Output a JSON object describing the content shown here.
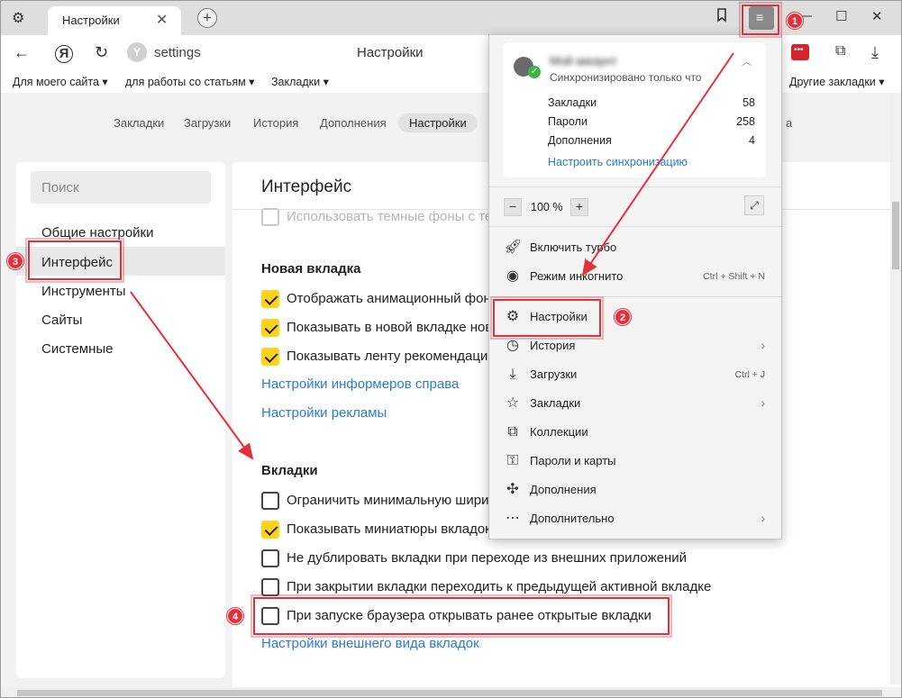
{
  "browser": {
    "tab_title": "Настройки",
    "tab_close": "✕",
    "new_tab": "+",
    "url": "settings",
    "page_title": "Настройки",
    "ya_logo": "Я",
    "bookmarks_bar": [
      "Для моего сайта ▾",
      "для работы со статьям ▾",
      "Закладки ▾"
    ],
    "other_bookmarks": "Другие закладки ▾"
  },
  "settings_tabs": [
    "Закладки",
    "Загрузки",
    "История",
    "Дополнения",
    "Настройки"
  ],
  "settings_tabs_overflow": "а",
  "sidebar": {
    "search_placeholder": "Поиск",
    "items": [
      "Общие настройки",
      "Интерфейс",
      "Инструменты",
      "Сайты",
      "Системные"
    ],
    "active_index": 1
  },
  "main": {
    "title": "Интерфейс",
    "dark_bg_row": "Использовать темные фоны с те",
    "new_tab_section": "Новая вкладка",
    "new_tab_options": [
      {
        "label": "Отображать анимационный фон",
        "checked": true
      },
      {
        "label": "Показывать в новой вкладке нов",
        "checked": true
      },
      {
        "label": "Показывать ленту рекомендаци",
        "checked": true
      }
    ],
    "links_1": [
      "Настройки информеров справа",
      "Настройки рекламы"
    ],
    "tabs_section": "Вкладки",
    "tabs_options": [
      {
        "label": "Ограничить минимальную шири",
        "checked": false
      },
      {
        "label": "Показывать миниатюры вкладок",
        "checked": true
      },
      {
        "label": "Не дублировать вкладки при переходе из внешних приложений",
        "checked": false
      },
      {
        "label": "При закрытии вкладки переходить к предыдущей активной вкладке",
        "checked": false
      },
      {
        "label": "При запуске браузера открывать ранее открытые вкладки",
        "checked": false
      }
    ],
    "tabs_link": "Настройки внешнего вида вкладок"
  },
  "menu": {
    "account_name": "Мой аккаунт",
    "sync_status": "Синхронизировано только что",
    "sync_items": [
      {
        "label": "Закладки",
        "value": "58"
      },
      {
        "label": "Пароли",
        "value": "258"
      },
      {
        "label": "Дополнения",
        "value": "4"
      }
    ],
    "sync_link": "Настроить синхронизацию",
    "zoom_minus": "−",
    "zoom_value": "100 %",
    "zoom_plus": "+",
    "items": [
      {
        "label": "Включить турбо",
        "icon": "rocket-icon",
        "shortcut": "",
        "arrow": false
      },
      {
        "label": "Режим инкогнито",
        "icon": "mask-icon",
        "shortcut": "Ctrl + Shift + N",
        "arrow": false
      },
      {
        "label": "Настройки",
        "icon": "gear-icon",
        "shortcut": "",
        "arrow": false
      },
      {
        "label": "История",
        "icon": "clock-icon",
        "shortcut": "",
        "arrow": true
      },
      {
        "label": "Загрузки",
        "icon": "download-icon",
        "shortcut": "Ctrl + J",
        "arrow": false
      },
      {
        "label": "Закладки",
        "icon": "star-icon",
        "shortcut": "",
        "arrow": true
      },
      {
        "label": "Коллекции",
        "icon": "collections-icon",
        "shortcut": "",
        "arrow": false
      },
      {
        "label": "Пароли и карты",
        "icon": "key-icon",
        "shortcut": "",
        "arrow": false
      },
      {
        "label": "Дополнения",
        "icon": "puzzle-icon",
        "shortcut": "",
        "arrow": false
      },
      {
        "label": "Дополнительно",
        "icon": "more-icon",
        "shortcut": "",
        "arrow": true
      }
    ]
  },
  "annotations": [
    "1",
    "2",
    "3",
    "4"
  ],
  "colors": {
    "accent_link": "#2a7ad5",
    "checkbox_on": "#ffd21e",
    "annotation": "#e4303d"
  }
}
